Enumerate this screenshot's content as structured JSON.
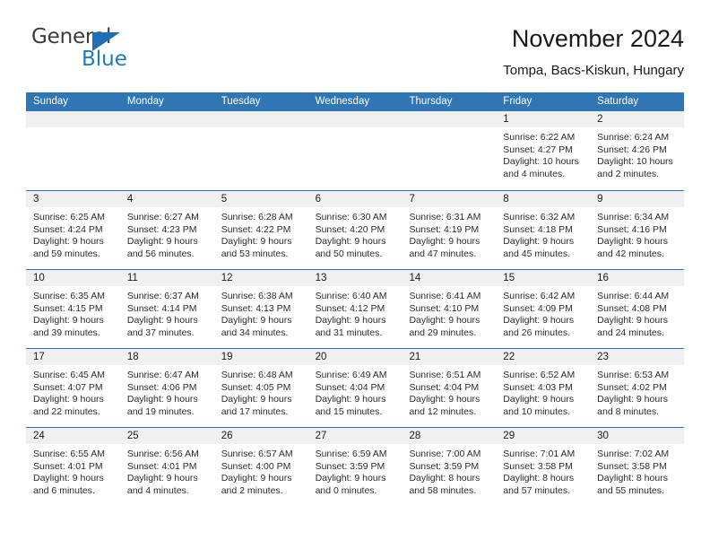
{
  "brand": {
    "name_part1": "General",
    "name_part2": "Blue",
    "flag_icon": "triangle-flag-icon",
    "accent_color": "#1f7ac4"
  },
  "header": {
    "title": "November 2024",
    "subtitle": "Tompa, Bacs-Kiskun, Hungary"
  },
  "theme": {
    "header_blue": "#3075b4",
    "day_band_gray": "#f0f0f0",
    "text": "#1a1a1a"
  },
  "weekdays": [
    "Sunday",
    "Monday",
    "Tuesday",
    "Wednesday",
    "Thursday",
    "Friday",
    "Saturday"
  ],
  "weeks": [
    [
      {
        "day": "",
        "empty": true,
        "sunrise": "",
        "sunset": "",
        "daylight": ""
      },
      {
        "day": "",
        "empty": true,
        "sunrise": "",
        "sunset": "",
        "daylight": ""
      },
      {
        "day": "",
        "empty": true,
        "sunrise": "",
        "sunset": "",
        "daylight": ""
      },
      {
        "day": "",
        "empty": true,
        "sunrise": "",
        "sunset": "",
        "daylight": ""
      },
      {
        "day": "",
        "empty": true,
        "sunrise": "",
        "sunset": "",
        "daylight": ""
      },
      {
        "day": "1",
        "empty": false,
        "sunrise": "Sunrise: 6:22 AM",
        "sunset": "Sunset: 4:27 PM",
        "daylight": "Daylight: 10 hours and 4 minutes."
      },
      {
        "day": "2",
        "empty": false,
        "sunrise": "Sunrise: 6:24 AM",
        "sunset": "Sunset: 4:26 PM",
        "daylight": "Daylight: 10 hours and 2 minutes."
      }
    ],
    [
      {
        "day": "3",
        "empty": false,
        "sunrise": "Sunrise: 6:25 AM",
        "sunset": "Sunset: 4:24 PM",
        "daylight": "Daylight: 9 hours and 59 minutes."
      },
      {
        "day": "4",
        "empty": false,
        "sunrise": "Sunrise: 6:27 AM",
        "sunset": "Sunset: 4:23 PM",
        "daylight": "Daylight: 9 hours and 56 minutes."
      },
      {
        "day": "5",
        "empty": false,
        "sunrise": "Sunrise: 6:28 AM",
        "sunset": "Sunset: 4:22 PM",
        "daylight": "Daylight: 9 hours and 53 minutes."
      },
      {
        "day": "6",
        "empty": false,
        "sunrise": "Sunrise: 6:30 AM",
        "sunset": "Sunset: 4:20 PM",
        "daylight": "Daylight: 9 hours and 50 minutes."
      },
      {
        "day": "7",
        "empty": false,
        "sunrise": "Sunrise: 6:31 AM",
        "sunset": "Sunset: 4:19 PM",
        "daylight": "Daylight: 9 hours and 47 minutes."
      },
      {
        "day": "8",
        "empty": false,
        "sunrise": "Sunrise: 6:32 AM",
        "sunset": "Sunset: 4:18 PM",
        "daylight": "Daylight: 9 hours and 45 minutes."
      },
      {
        "day": "9",
        "empty": false,
        "sunrise": "Sunrise: 6:34 AM",
        "sunset": "Sunset: 4:16 PM",
        "daylight": "Daylight: 9 hours and 42 minutes."
      }
    ],
    [
      {
        "day": "10",
        "empty": false,
        "sunrise": "Sunrise: 6:35 AM",
        "sunset": "Sunset: 4:15 PM",
        "daylight": "Daylight: 9 hours and 39 minutes."
      },
      {
        "day": "11",
        "empty": false,
        "sunrise": "Sunrise: 6:37 AM",
        "sunset": "Sunset: 4:14 PM",
        "daylight": "Daylight: 9 hours and 37 minutes."
      },
      {
        "day": "12",
        "empty": false,
        "sunrise": "Sunrise: 6:38 AM",
        "sunset": "Sunset: 4:13 PM",
        "daylight": "Daylight: 9 hours and 34 minutes."
      },
      {
        "day": "13",
        "empty": false,
        "sunrise": "Sunrise: 6:40 AM",
        "sunset": "Sunset: 4:12 PM",
        "daylight": "Daylight: 9 hours and 31 minutes."
      },
      {
        "day": "14",
        "empty": false,
        "sunrise": "Sunrise: 6:41 AM",
        "sunset": "Sunset: 4:10 PM",
        "daylight": "Daylight: 9 hours and 29 minutes."
      },
      {
        "day": "15",
        "empty": false,
        "sunrise": "Sunrise: 6:42 AM",
        "sunset": "Sunset: 4:09 PM",
        "daylight": "Daylight: 9 hours and 26 minutes."
      },
      {
        "day": "16",
        "empty": false,
        "sunrise": "Sunrise: 6:44 AM",
        "sunset": "Sunset: 4:08 PM",
        "daylight": "Daylight: 9 hours and 24 minutes."
      }
    ],
    [
      {
        "day": "17",
        "empty": false,
        "sunrise": "Sunrise: 6:45 AM",
        "sunset": "Sunset: 4:07 PM",
        "daylight": "Daylight: 9 hours and 22 minutes."
      },
      {
        "day": "18",
        "empty": false,
        "sunrise": "Sunrise: 6:47 AM",
        "sunset": "Sunset: 4:06 PM",
        "daylight": "Daylight: 9 hours and 19 minutes."
      },
      {
        "day": "19",
        "empty": false,
        "sunrise": "Sunrise: 6:48 AM",
        "sunset": "Sunset: 4:05 PM",
        "daylight": "Daylight: 9 hours and 17 minutes."
      },
      {
        "day": "20",
        "empty": false,
        "sunrise": "Sunrise: 6:49 AM",
        "sunset": "Sunset: 4:04 PM",
        "daylight": "Daylight: 9 hours and 15 minutes."
      },
      {
        "day": "21",
        "empty": false,
        "sunrise": "Sunrise: 6:51 AM",
        "sunset": "Sunset: 4:04 PM",
        "daylight": "Daylight: 9 hours and 12 minutes."
      },
      {
        "day": "22",
        "empty": false,
        "sunrise": "Sunrise: 6:52 AM",
        "sunset": "Sunset: 4:03 PM",
        "daylight": "Daylight: 9 hours and 10 minutes."
      },
      {
        "day": "23",
        "empty": false,
        "sunrise": "Sunrise: 6:53 AM",
        "sunset": "Sunset: 4:02 PM",
        "daylight": "Daylight: 9 hours and 8 minutes."
      }
    ],
    [
      {
        "day": "24",
        "empty": false,
        "sunrise": "Sunrise: 6:55 AM",
        "sunset": "Sunset: 4:01 PM",
        "daylight": "Daylight: 9 hours and 6 minutes."
      },
      {
        "day": "25",
        "empty": false,
        "sunrise": "Sunrise: 6:56 AM",
        "sunset": "Sunset: 4:01 PM",
        "daylight": "Daylight: 9 hours and 4 minutes."
      },
      {
        "day": "26",
        "empty": false,
        "sunrise": "Sunrise: 6:57 AM",
        "sunset": "Sunset: 4:00 PM",
        "daylight": "Daylight: 9 hours and 2 minutes."
      },
      {
        "day": "27",
        "empty": false,
        "sunrise": "Sunrise: 6:59 AM",
        "sunset": "Sunset: 3:59 PM",
        "daylight": "Daylight: 9 hours and 0 minutes."
      },
      {
        "day": "28",
        "empty": false,
        "sunrise": "Sunrise: 7:00 AM",
        "sunset": "Sunset: 3:59 PM",
        "daylight": "Daylight: 8 hours and 58 minutes."
      },
      {
        "day": "29",
        "empty": false,
        "sunrise": "Sunrise: 7:01 AM",
        "sunset": "Sunset: 3:58 PM",
        "daylight": "Daylight: 8 hours and 57 minutes."
      },
      {
        "day": "30",
        "empty": false,
        "sunrise": "Sunrise: 7:02 AM",
        "sunset": "Sunset: 3:58 PM",
        "daylight": "Daylight: 8 hours and 55 minutes."
      }
    ]
  ]
}
